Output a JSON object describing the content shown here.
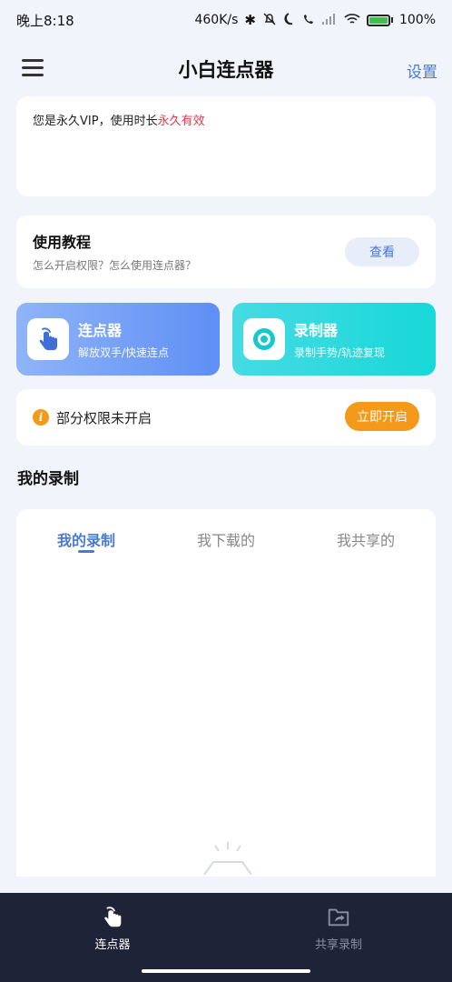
{
  "status_bar": {
    "time": "晚上8:18",
    "network_speed": "460K/s",
    "battery": "100%",
    "icons": [
      "moon-icon",
      "bluetooth-icon",
      "mute-icon",
      "call-icon",
      "signal-icon",
      "wifi-icon",
      "battery-icon"
    ]
  },
  "header": {
    "title": "小白连点器",
    "settings_label": "设置"
  },
  "vip": {
    "prefix": "您是永久VIP，使用时长",
    "highlight": "永久有效",
    "highlight_color": "#e0384a"
  },
  "tutorial": {
    "title": "使用教程",
    "description": "怎么开启权限？怎么使用连点器？",
    "button_label": "查看"
  },
  "features": {
    "clicker": {
      "title": "连点器",
      "subtitle": "解放双手/快速连点"
    },
    "recorder": {
      "title": "录制器",
      "subtitle": "录制手势/轨迹复现"
    }
  },
  "permission": {
    "text": "部分权限未开启",
    "button_label": "立即开启",
    "accent": "#f39a1b"
  },
  "records": {
    "section_title": "我的录制",
    "tabs": [
      {
        "label": "我的录制"
      },
      {
        "label": "我下载的"
      },
      {
        "label": "我共享的"
      }
    ],
    "active_tab": 0
  },
  "bottom_nav": {
    "items": [
      {
        "label": "连点器",
        "icon": "tap-hand-icon"
      },
      {
        "label": "共享录制",
        "icon": "share-folder-icon"
      }
    ]
  },
  "colors": {
    "accent": "#4a7bd0",
    "background": "#f1f4fb",
    "nav_background": "#1e2337"
  }
}
